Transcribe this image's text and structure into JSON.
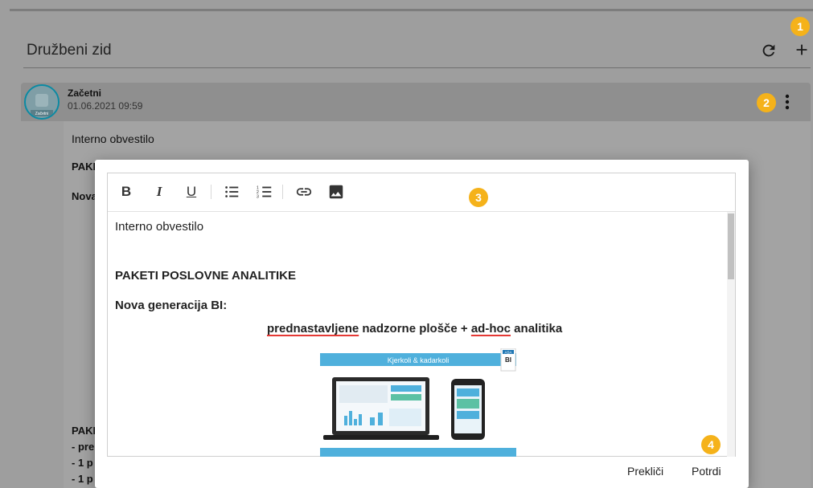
{
  "wall": {
    "title": "Družbeni zid"
  },
  "header_actions": {
    "refresh_icon": "refresh-icon",
    "add_icon": "plus-icon"
  },
  "badges": {
    "b1": "1",
    "b2": "2",
    "b3": "3",
    "b4": "4"
  },
  "post": {
    "author": "Začetni",
    "date": "01.06.2021 09:59",
    "avatar_label": "Začetni",
    "menu_icon": "kebab-icon",
    "visible_fragments": [
      "Interno obvestilo",
      "PAKI",
      "Nova",
      "PAKI",
      "- pre",
      "- 1 p",
      "- 1 p"
    ]
  },
  "toolbar": {
    "bold": "B",
    "italic": "I",
    "underline": "U",
    "bullets_icon": "bulleted-list-icon",
    "numbers_icon": "numbered-list-icon",
    "link_icon": "link-icon",
    "image_icon": "image-icon"
  },
  "editor": {
    "line1": "Interno obvestilo",
    "line2": "PAKETI POSLOVNE ANALITIKE",
    "line3": "Nova generacija BI:",
    "tag_a": "prednastavljene",
    "tag_b": " nadzorne plošče + ",
    "tag_c": "ad-hoc",
    "tag_d": " analitika",
    "image_banner": "Kjerkoli & kadarkoli",
    "image_logo": "BI",
    "image_logo_top": "ASA"
  },
  "dialog": {
    "cancel_label": "Prekliči",
    "confirm_label": "Potrdi"
  },
  "colors": {
    "badge": "#f5b21a",
    "banner": "#4fb0dc",
    "spell": "#e53935",
    "avatar_ring": "#0b8aa3"
  }
}
